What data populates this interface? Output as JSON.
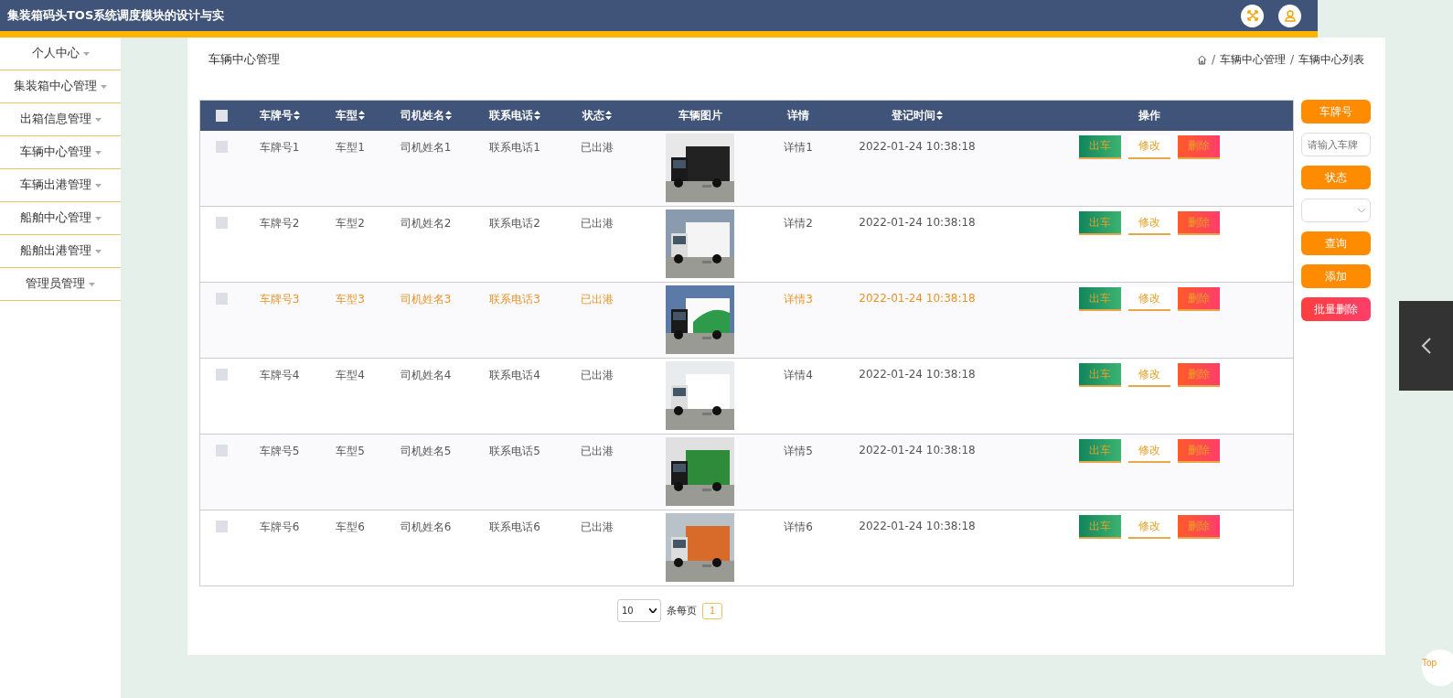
{
  "header": {
    "title": "集装箱码头TOS系统调度模块的设计与实"
  },
  "sidebar": {
    "items": [
      {
        "label": "个人中心"
      },
      {
        "label": "集装箱中心管理"
      },
      {
        "label": "出箱信息管理"
      },
      {
        "label": "车辆中心管理"
      },
      {
        "label": "车辆出港管理"
      },
      {
        "label": "船舶中心管理"
      },
      {
        "label": "船舶出港管理"
      },
      {
        "label": "管理员管理"
      }
    ]
  },
  "page": {
    "title": "车辆中心管理",
    "breadcrumb": [
      {
        "label": "/",
        "kind": "separator"
      },
      {
        "label": "车辆中心管理",
        "kind": "link"
      },
      {
        "label": "/",
        "kind": "separator"
      },
      {
        "label": "车辆中心列表",
        "kind": "link"
      }
    ]
  },
  "table": {
    "columns": [
      {
        "label": "车牌号",
        "sortable": true
      },
      {
        "label": "车型",
        "sortable": true
      },
      {
        "label": "司机姓名",
        "sortable": true
      },
      {
        "label": "联系电话",
        "sortable": true
      },
      {
        "label": "状态",
        "sortable": true
      },
      {
        "label": "车辆图片",
        "sortable": false
      },
      {
        "label": "详情",
        "sortable": false
      },
      {
        "label": "登记时间",
        "sortable": true
      },
      {
        "label": "操作",
        "sortable": false
      }
    ],
    "all_checked": false,
    "rows": [
      {
        "plate": "车牌号1",
        "model": "车型1",
        "driver": "司机姓名1",
        "phone": "联系电话1",
        "status": "已出港",
        "detail": "详情1",
        "time": "2022-01-24 10:38:18",
        "highlighted": false,
        "checked": false,
        "photo": {
          "kind": "picture"
        },
        "actions": [
          "出车",
          "修改",
          "删除"
        ]
      },
      {
        "plate": "车牌号2",
        "model": "车型2",
        "driver": "司机姓名2",
        "phone": "联系电话2",
        "status": "已出港",
        "detail": "详情2",
        "time": "2022-01-24 10:38:18",
        "highlighted": false,
        "checked": false,
        "photo": {
          "kind": "picture"
        },
        "actions": [
          "出车",
          "修改",
          "删除"
        ]
      },
      {
        "plate": "车牌号3",
        "model": "车型3",
        "driver": "司机姓名3",
        "phone": "联系电话3",
        "status": "已出港",
        "detail": "详情3",
        "time": "2022-01-24 10:38:18",
        "highlighted": true,
        "checked": false,
        "photo": {
          "kind": "picture"
        },
        "actions": [
          "出车",
          "修改",
          "删除"
        ]
      },
      {
        "plate": "车牌号4",
        "model": "车型4",
        "driver": "司机姓名4",
        "phone": "联系电话4",
        "status": "已出港",
        "detail": "详情4",
        "time": "2022-01-24 10:38:18",
        "highlighted": false,
        "checked": false,
        "photo": {
          "kind": "picture"
        },
        "actions": [
          "出车",
          "修改",
          "删除"
        ]
      },
      {
        "plate": "车牌号5",
        "model": "车型5",
        "driver": "司机姓名5",
        "phone": "联系电话5",
        "status": "已出港",
        "detail": "详情5",
        "time": "2022-01-24 10:38:18",
        "highlighted": false,
        "checked": false,
        "photo": {
          "kind": "picture"
        },
        "actions": [
          "出车",
          "修改",
          "删除"
        ]
      },
      {
        "plate": "车牌号6",
        "model": "车型6",
        "driver": "司机姓名6",
        "phone": "联系电话6",
        "status": "已出港",
        "detail": "详情6",
        "time": "2022-01-24 10:38:18",
        "highlighted": false,
        "checked": false,
        "photo": {
          "kind": "picture"
        },
        "actions": [
          "出车",
          "修改",
          "删除"
        ]
      }
    ]
  },
  "search": {
    "plate_label": "车牌号",
    "plate_placeholder": "请输入车牌",
    "status_label": "状态",
    "buttons": [
      {
        "label": "查询",
        "kind": "primary"
      },
      {
        "label": "添加",
        "kind": "primary"
      },
      {
        "label": "批量删除",
        "kind": "danger"
      }
    ]
  },
  "pagination": {
    "page_size": "10",
    "per_page_label": "条每页",
    "pages": [
      {
        "label": "1",
        "selected": true
      }
    ]
  },
  "back_to_top": "Top"
}
